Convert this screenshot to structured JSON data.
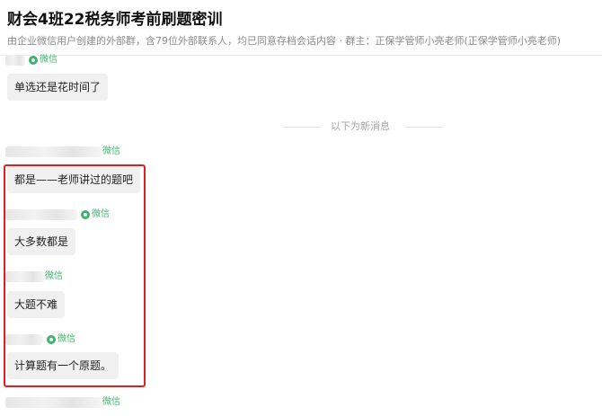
{
  "header": {
    "title": "财会4班22税务师考前刷题密训",
    "subtitle": "由企业微信用户创建的外部群，含79位外部联系人，均已同意存档会话内容 · 群主：正保学管师小亮老师(正保学管师小亮老师)"
  },
  "wechat_tag": "微信",
  "system_notice": "以下为新消息",
  "messages": [
    {
      "text": "单选还是花时间了"
    },
    {
      "text": "都是——老师讲过的题吧"
    },
    {
      "text": "大多数都是"
    },
    {
      "text": "大题不难"
    },
    {
      "text": "计算题有一个原题。"
    }
  ],
  "colors": {
    "accent_green": "#3fb36b",
    "highlight_red": "#e02020",
    "bubble_gray": "#f0f0f0"
  }
}
